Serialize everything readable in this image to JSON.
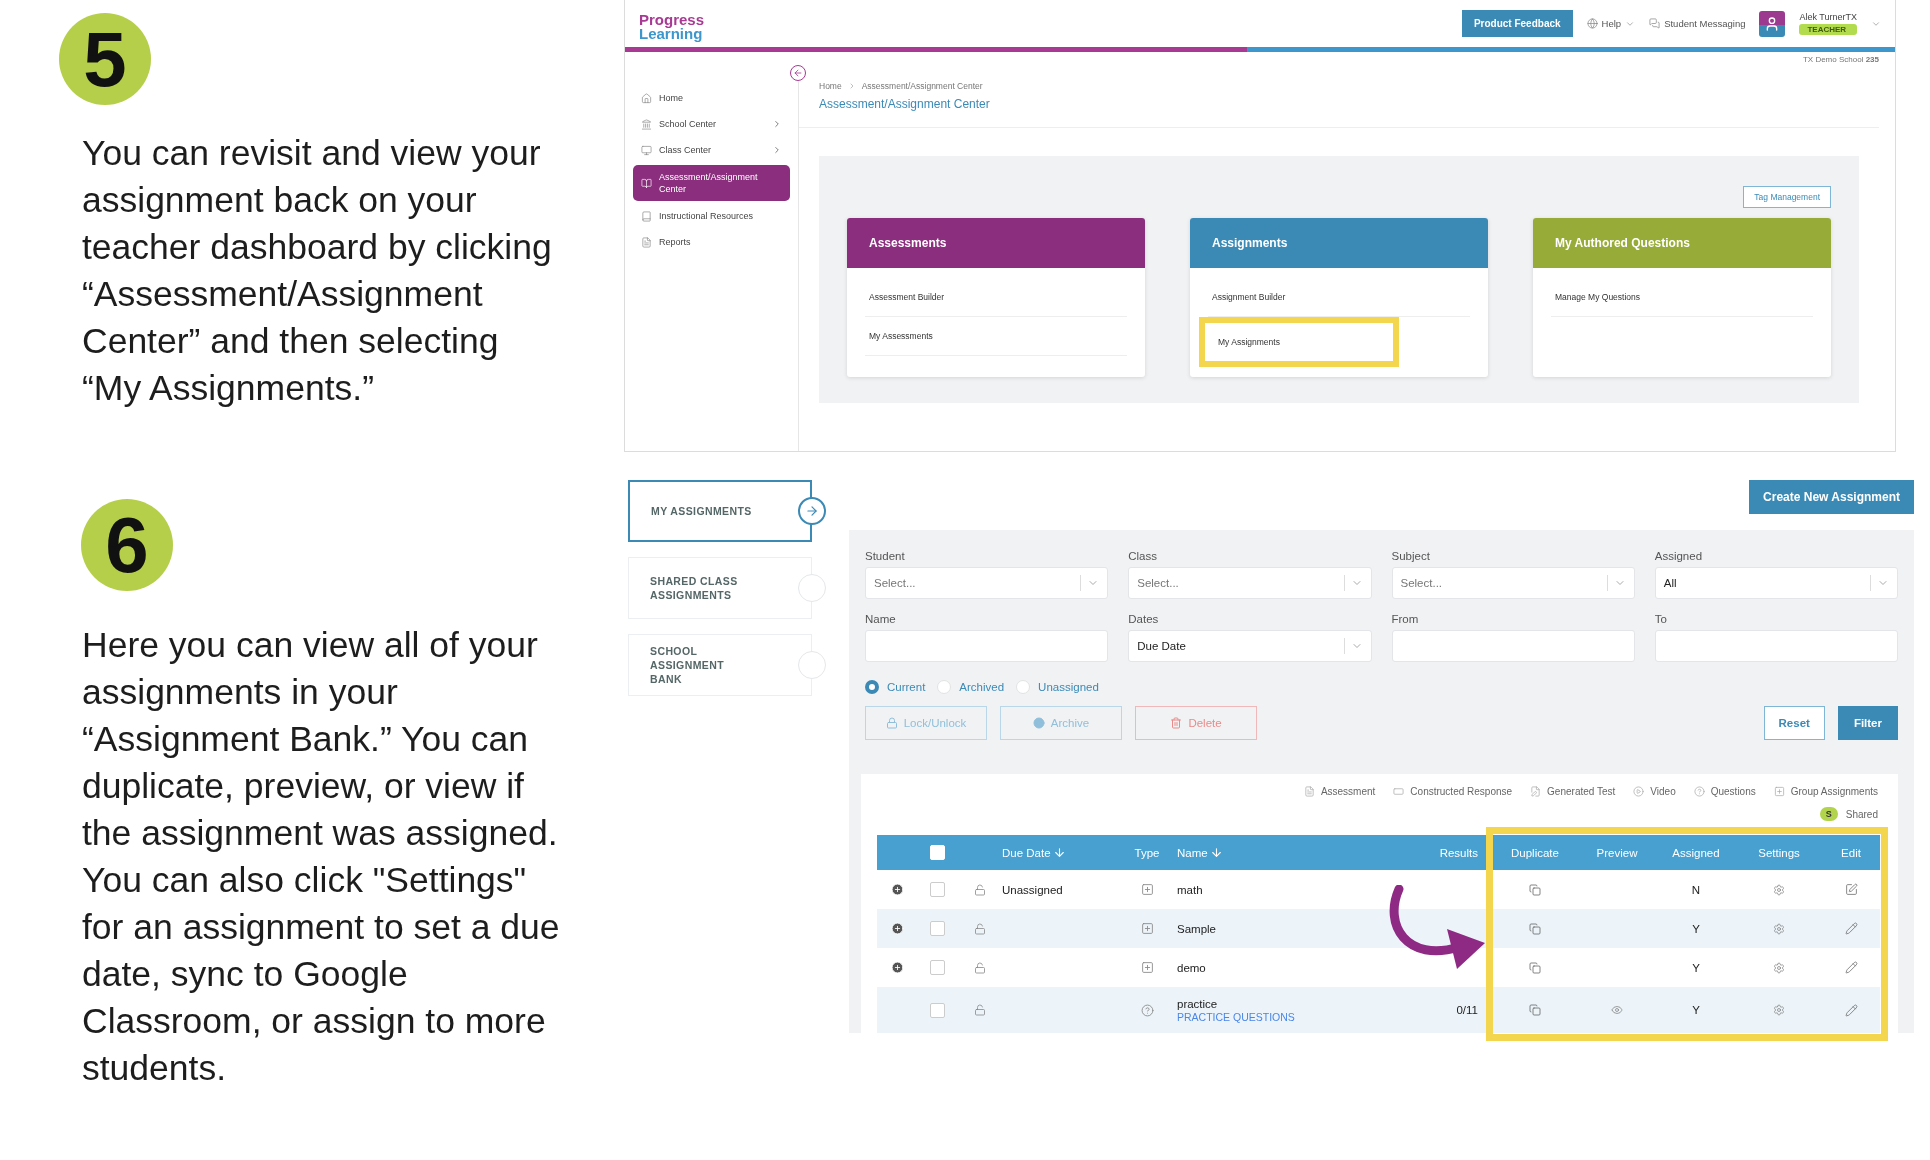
{
  "steps": [
    {
      "number": "5",
      "text": "You can revisit and view your assignment back on your teacher dashboard by clicking “Assessment/Assignment Center” and then selecting “My Assignments.”"
    },
    {
      "number": "6",
      "text": "Here you can view all of your assignments in your “Assignment Bank.” You can duplicate, preview, or view if the assignment was assigned. You can also click \"Settings\" for an assignment to set a due date, sync to Google Classroom, or assign to more students."
    }
  ],
  "dashboard": {
    "logo": [
      "Progress",
      "Learning"
    ],
    "feedback_button": "Product Feedback",
    "help": "Help",
    "messaging": "Student Messaging",
    "user": {
      "name": "Alek TurnerTX",
      "role": "TEACHER"
    },
    "school": "TX Demo School **235**",
    "sidebar": [
      {
        "label": "Home",
        "selected": false,
        "has_children": false
      },
      {
        "label": "School Center",
        "selected": false,
        "has_children": true
      },
      {
        "label": "Class Center",
        "selected": false,
        "has_children": true
      },
      {
        "label": "Assessment/Assignment Center",
        "selected": true,
        "has_children": false
      },
      {
        "label": "Instructional Resources",
        "selected": false,
        "has_children": false
      },
      {
        "label": "Reports",
        "selected": false,
        "has_children": false
      }
    ],
    "breadcrumb": [
      "Home",
      "Assessment/Assignment Center"
    ],
    "page_title": "Assessment/Assignment Center",
    "tag_button": "Tag Management",
    "cards": [
      {
        "title": "Assessments",
        "color": "#8a2e7d",
        "links": [
          {
            "label": "Assessment Builder",
            "highlighted": false
          },
          {
            "label": "My Assessments",
            "highlighted": false
          }
        ]
      },
      {
        "title": "Assignments",
        "color": "#3b8ab6",
        "links": [
          {
            "label": "Assignment Builder",
            "highlighted": false
          },
          {
            "label": "My Assignments",
            "highlighted": true
          }
        ]
      },
      {
        "title": "My Authored Questions",
        "color": "#97ab38",
        "links": [
          {
            "label": "Manage My Questions",
            "highlighted": false
          }
        ]
      }
    ]
  },
  "assignments": {
    "tabs": [
      {
        "label": "MY ASSIGNMENTS",
        "selected": true
      },
      {
        "label": "SHARED CLASS ASSIGNMENTS",
        "selected": false
      },
      {
        "label": "SCHOOL ASSIGNMENT BANK",
        "selected": false
      }
    ],
    "create_button": "Create New Assignment",
    "filters": [
      {
        "label": "Student",
        "kind": "select",
        "placeholder": "Select..."
      },
      {
        "label": "Class",
        "kind": "select",
        "placeholder": "Select..."
      },
      {
        "label": "Subject",
        "kind": "select",
        "placeholder": "Select..."
      },
      {
        "label": "Assigned",
        "kind": "select",
        "value": "All"
      },
      {
        "label": "Name",
        "kind": "text"
      },
      {
        "label": "Dates",
        "kind": "select",
        "value": "Due Date"
      },
      {
        "label": "From",
        "kind": "text"
      },
      {
        "label": "To",
        "kind": "text"
      }
    ],
    "status_options": [
      {
        "label": "Current",
        "selected": true
      },
      {
        "label": "Archived",
        "selected": false
      },
      {
        "label": "Unassigned",
        "selected": false
      }
    ],
    "action_buttons": [
      {
        "label": "Lock/Unlock",
        "kind": "lock",
        "disabled": true
      },
      {
        "label": "Archive",
        "kind": "archive",
        "disabled": true
      },
      {
        "label": "Delete",
        "kind": "delete",
        "disabled": true
      }
    ],
    "reset_button": "Reset",
    "filter_button": "Filter",
    "legend": [
      "Assessment",
      "Constructed Response",
      "Generated Test",
      "Video",
      "Questions",
      "Group Assignments"
    ],
    "shared": {
      "badge": "S",
      "label": "Shared"
    },
    "table": {
      "select_all_checked": false,
      "highlighted": true,
      "columns": [
        {
          "label": "Due Date",
          "sortable": true
        },
        {
          "label": "Type",
          "sortable": false
        },
        {
          "label": "Name",
          "sortable": true
        },
        {
          "label": "Results",
          "sortable": false
        },
        {
          "label": "Duplicate",
          "sortable": false
        },
        {
          "label": "Preview",
          "sortable": false
        },
        {
          "label": "Assigned",
          "sortable": false
        },
        {
          "label": "Settings",
          "sortable": false
        },
        {
          "label": "Edit",
          "sortable": false
        }
      ],
      "rows": [
        {
          "expandable": true,
          "checked": false,
          "due_date": "Unassigned",
          "kind": "group",
          "name": "math",
          "previewable": false,
          "assigned": "N",
          "full_edit": true
        },
        {
          "expandable": true,
          "checked": false,
          "kind": "group",
          "name": "Sample",
          "previewable": false,
          "assigned": "Y",
          "full_edit": false
        },
        {
          "expandable": true,
          "checked": false,
          "kind": "group",
          "name": "demo",
          "previewable": false,
          "assigned": "Y",
          "full_edit": false
        },
        {
          "expandable": false,
          "checked": false,
          "kind": "practice",
          "name": "practice",
          "subtitle": "PRACTICE QUESTIONS",
          "results": "0/11",
          "previewable": true,
          "assigned": "Y",
          "full_edit": false
        }
      ]
    }
  }
}
